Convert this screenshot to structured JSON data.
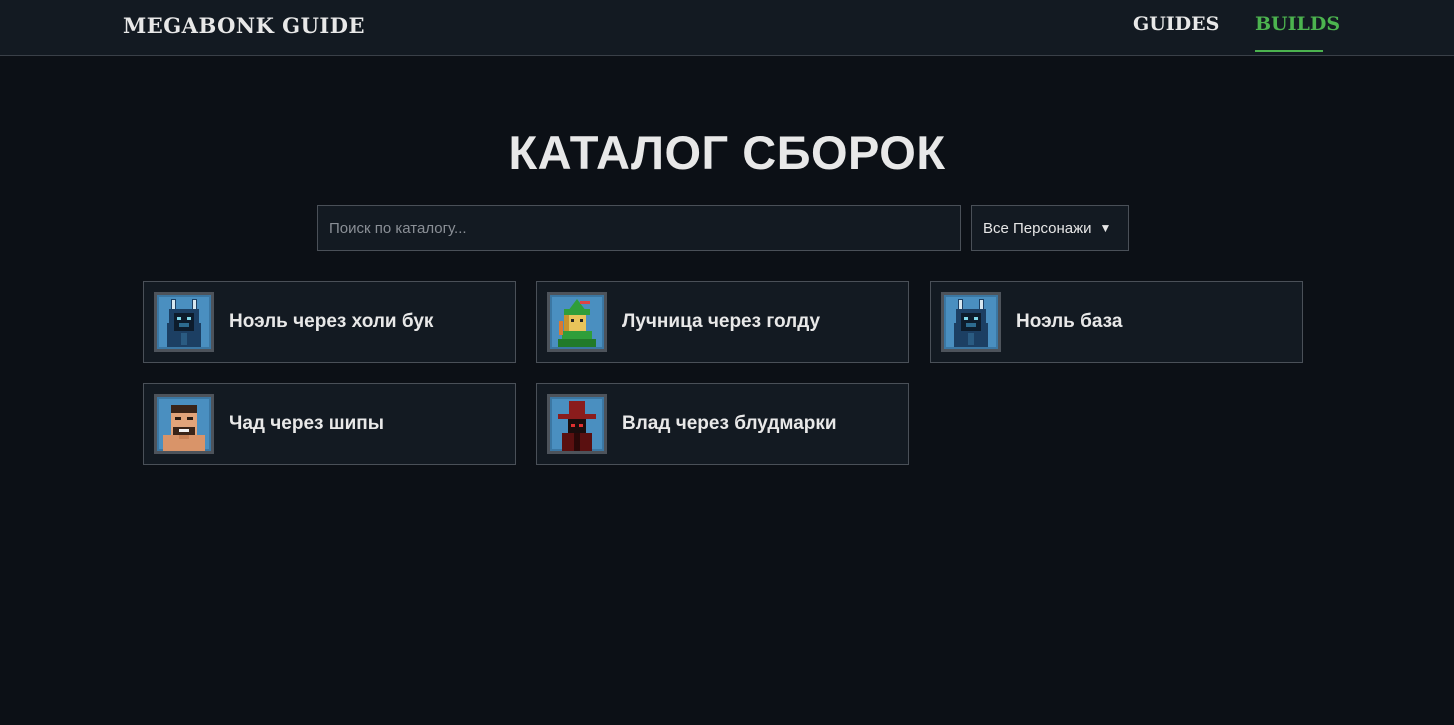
{
  "header": {
    "logo": "MEGABONK GUIDE",
    "nav": [
      {
        "label": "GUIDES"
      },
      {
        "label": "BUILDS"
      }
    ]
  },
  "main": {
    "title": "КАТАЛОГ СБОРОК",
    "search": {
      "placeholder": "Поиск по каталогу...",
      "value": ""
    },
    "filter": {
      "selected": "Все Персонажи"
    }
  },
  "builds": [
    {
      "title": "Ноэль через холи бук",
      "character_icon": "noelle-portrait-icon"
    },
    {
      "title": "Лучница через голду",
      "character_icon": "archer-portrait-icon"
    },
    {
      "title": "Ноэль база",
      "character_icon": "noelle-portrait-icon"
    },
    {
      "title": "Чад через шипы",
      "character_icon": "chad-portrait-icon"
    },
    {
      "title": "Влад через блудмарки",
      "character_icon": "vlad-portrait-icon"
    }
  ],
  "colors": {
    "background": "#0c1016",
    "panel": "#131a22",
    "accent": "#4cb34f",
    "border": "#4a5058"
  }
}
